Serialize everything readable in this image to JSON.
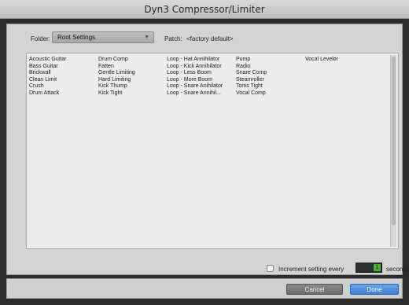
{
  "window": {
    "title": "Dyn3 Compressor/Limiter"
  },
  "toolbar": {
    "folder_label": "Folder:",
    "folder_value": "Root Settings",
    "patch_label": "Patch:",
    "patch_value": "<factory default>"
  },
  "presets": {
    "columns": [
      [
        "Acoustic Guitar",
        "Bass Guitar",
        "Brickwall",
        "Clean Limit",
        "Crush",
        "Drum Attack"
      ],
      [
        "Drum Comp",
        "Fatten",
        "Gentle Limiting",
        "Hard Limiting",
        "Kick Thump",
        "Kick Tight"
      ],
      [
        "Loop - Hat Annihilator",
        "Loop - Kick Annihilator",
        "Loop - Less Boom",
        "Loop - More Boom",
        "Loop - Snare Anihilator",
        "Loop - Snare Annihil..."
      ],
      [
        "Pump",
        "Radio",
        "Snare Comp",
        "Steamroller",
        "Toms Tight",
        "Vocal Comp"
      ],
      [
        "Vocal Levelor"
      ]
    ]
  },
  "increment": {
    "label": "Increment setting every",
    "value": "1",
    "unit": "seconds",
    "checked": false
  },
  "footer": {
    "cancel_label": "Cancel",
    "done_label": "Done"
  }
}
